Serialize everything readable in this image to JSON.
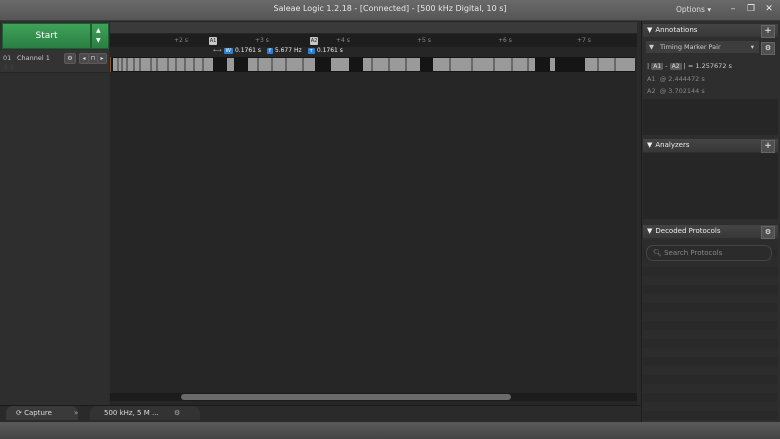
{
  "window": {
    "title": "Saleae Logic 1.2.18 - [Connected] - [500 kHz Digital, 10 s]",
    "options_label": "Options ▾"
  },
  "controls": {
    "start_label": "Start"
  },
  "channel": {
    "number": "01",
    "name": "Channel 1"
  },
  "ruler": {
    "ticks": [
      "+2 s",
      "+3 s",
      "+4 s",
      "+5 s",
      "+6 s",
      "+7 s"
    ]
  },
  "measurement": {
    "width_badge": "W",
    "width": "0.1761 s",
    "freq_badge": "f",
    "frequency": "5.677 Hz",
    "period_badge": "τ",
    "period": "0.1761 s"
  },
  "markers": {
    "a1": "A1",
    "a2": "A2"
  },
  "annotations": {
    "title": "Annotations",
    "pair_label": "Timing Marker Pair",
    "delta_a1": "A1",
    "delta_a2": "A2",
    "delta_text": "= 1.257672 s",
    "a1_label": "A1",
    "a1_value": "@ 2.444472 s",
    "a2_label": "A2",
    "a2_value": "@ 3.702144 s"
  },
  "analyzers": {
    "title": "Analyzers"
  },
  "decoded": {
    "title": "Decoded Protocols",
    "search_placeholder": "Search Protocols"
  },
  "tabs": {
    "capture": "Capture",
    "settings": "500 kHz, 5 M ..."
  },
  "colors": {
    "accent_green": "#2f8f4a",
    "badge_blue": "#2f7fd0",
    "panel_bg": "#2e2e2e"
  }
}
